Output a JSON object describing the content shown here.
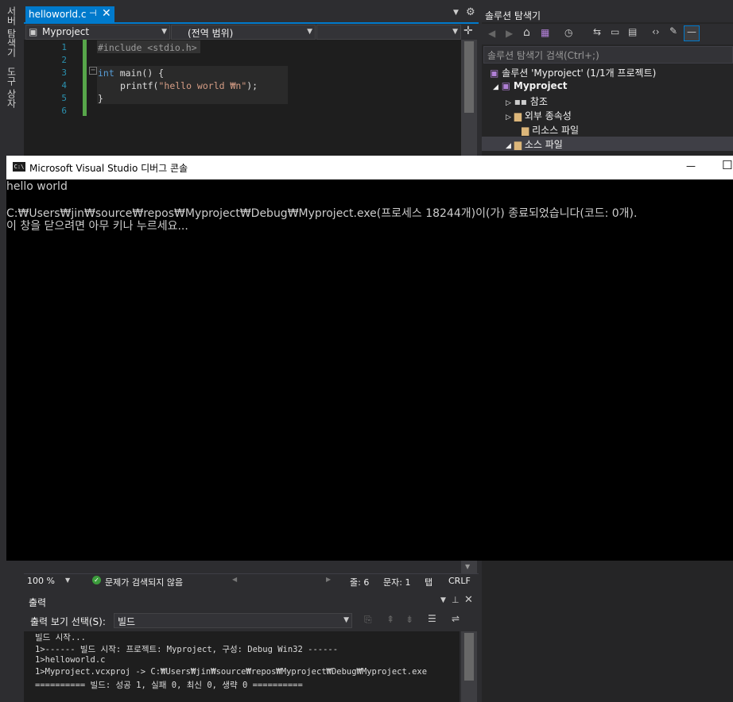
{
  "left_toolbar": {
    "server_explorer": "서버 탐색기",
    "toolbox": "도구 상자"
  },
  "document_tab": {
    "name": "helloworld.c",
    "pin": "⊣",
    "close": "✕"
  },
  "nav_bar": {
    "project": "Myproject",
    "scope": "(전역 범위)",
    "member": ""
  },
  "editor": {
    "line_numbers": [
      "1",
      "2",
      "3",
      "4",
      "5",
      "6"
    ],
    "lines": {
      "l1": "#include <stdio.h>",
      "l3_kw": "int",
      "l3_rest": " main() {",
      "l4_fn": "printf(",
      "l4_str": "\"hello world ₩n\"",
      "l4_end": ");",
      "l5": "}"
    },
    "colors": {
      "keyword": "#569cd6",
      "string": "#d69d85",
      "preproc": "#9b9b9b",
      "text": "#dcdcdc",
      "line_number": "#2b91af"
    }
  },
  "console": {
    "title": "Microsoft Visual Studio 디버그 콘솔",
    "icon_text": "C:\\",
    "minimize": "—",
    "maximize": "☐",
    "line1": "hello world",
    "line2": "C:₩Users₩jin₩source₩repos₩Myproject₩Debug₩Myproject.exe(프로세스 18244개)이(가) 종료되었습니다(코드: 0개).",
    "line3": "이 창을 닫으려면 아무 키나 누르세요..."
  },
  "solution_explorer": {
    "title": "솔루션 탐색기",
    "search_placeholder": "솔루션 탐색기 검색(Ctrl+;)",
    "tree": {
      "solution": "솔루션 'Myproject' (1/1개 프로젝트)",
      "project": "Myproject",
      "references": "참조",
      "external_deps": "외부 종속성",
      "resource_files": "리소스 파일",
      "source_files": "소스 파일"
    }
  },
  "editor_status": {
    "zoom": "100 %",
    "issues": "문제가 검색되지 않음",
    "line": "줄: 6",
    "col": "문자: 1",
    "tab": "탭",
    "eol": "CRLF"
  },
  "output": {
    "title": "출력",
    "show_label": "출력 보기 선택(S):",
    "source": "빌드",
    "lines": [
      "빌드 시작...",
      "1>------ 빌드 시작: 프로젝트: Myproject, 구성: Debug Win32 ------",
      "1>helloworld.c",
      "1>Myproject.vcxproj -> C:₩Users₩jin₩source₩repos₩Myproject₩Debug₩Myproject.exe",
      "========== 빌드: 성공 1, 실패 0, 최신 0, 생략 0 =========="
    ]
  }
}
